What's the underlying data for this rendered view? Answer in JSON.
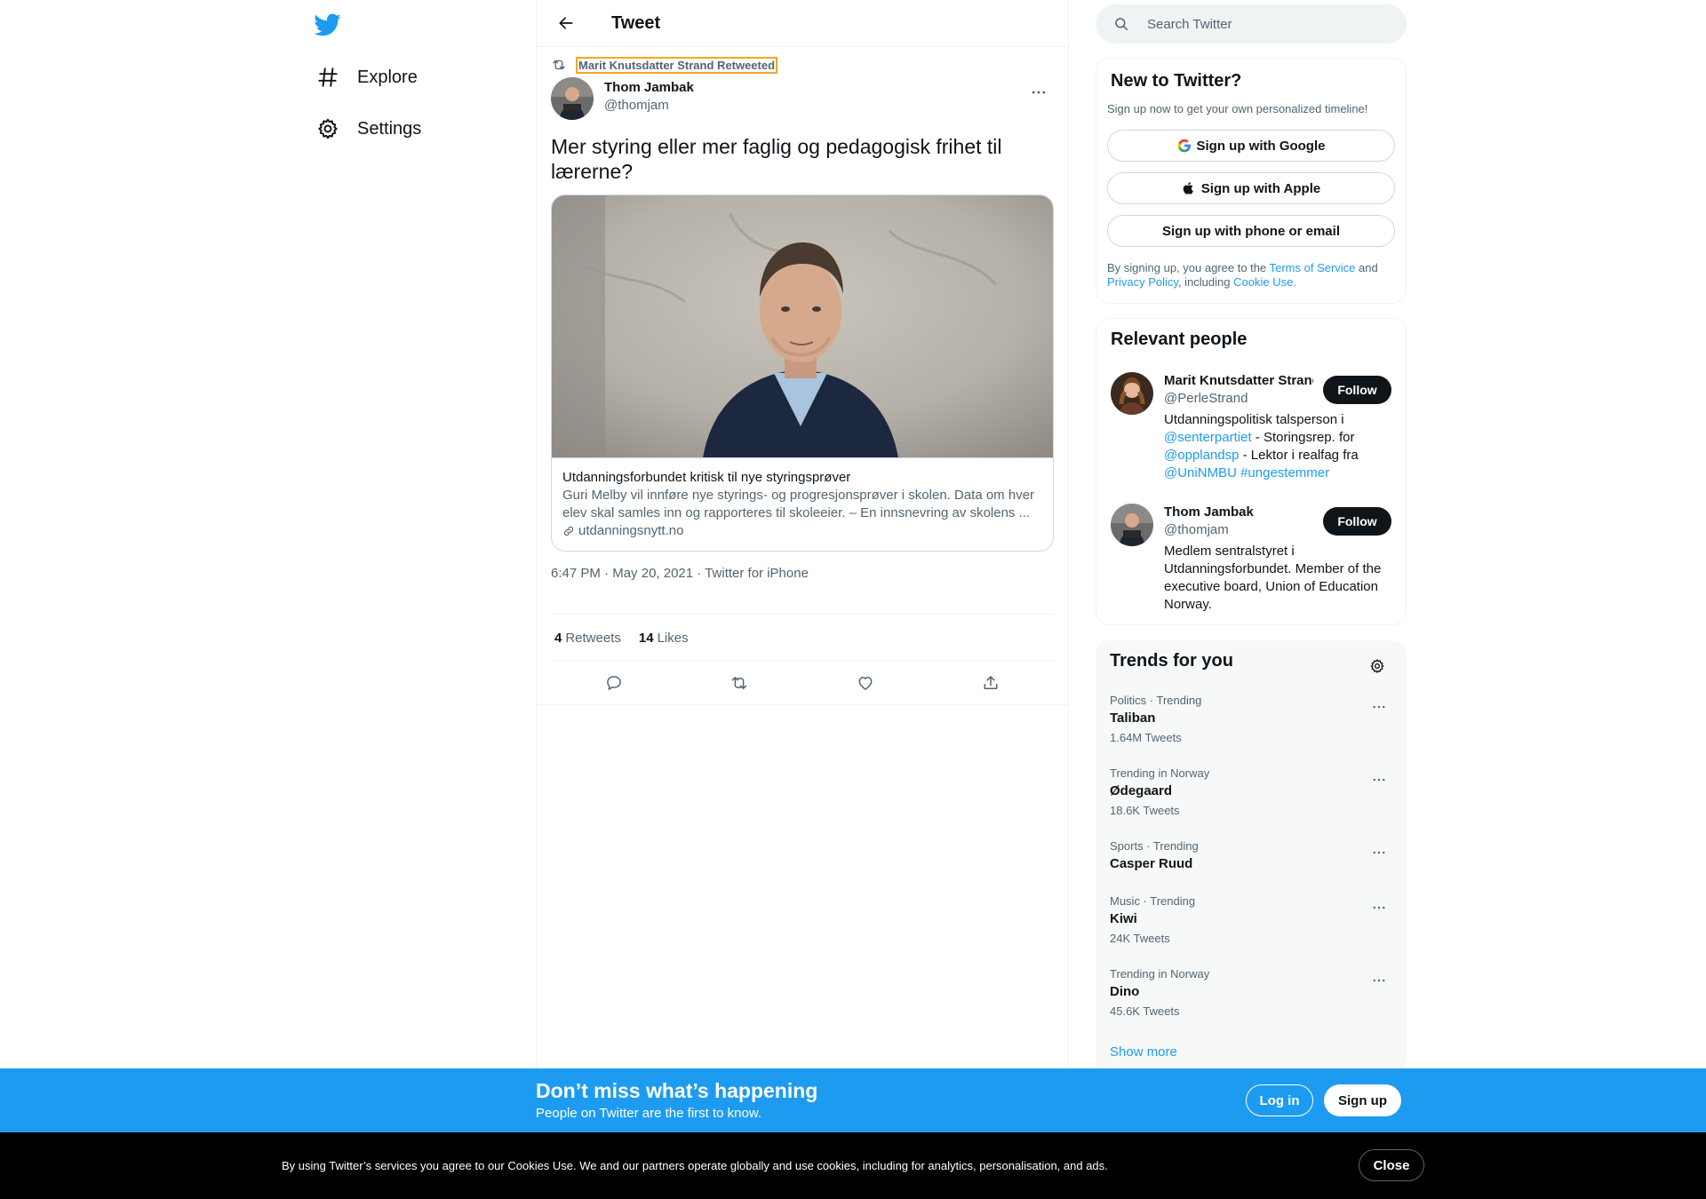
{
  "nav": {
    "items": [
      {
        "label": "Explore",
        "icon": "hash-icon"
      },
      {
        "label": "Settings",
        "icon": "gear-icon"
      }
    ]
  },
  "header": {
    "title": "Tweet"
  },
  "tweet": {
    "retweeted_by": "Marit Knutsdatter Strand Retweeted",
    "author_name": "Thom Jambak",
    "author_handle": "@thomjam",
    "text": "Mer styring eller mer faglig og pedagogisk frihet til lærerne?",
    "card": {
      "title": "Utdanningsforbundet kritisk til nye styringsprøver",
      "description_line1": "Guri Melby vil innføre nye styrings- og progresjonsprøver i skolen. Data om hver",
      "description_line2": "elev skal samles inn og rapporteres til skoleeier. – En innsnevring av skolens ...",
      "domain": "utdanningsnytt.no"
    },
    "time": "6:47 PM",
    "date": "May 20, 2021",
    "source": "Twitter for iPhone",
    "separator": " · ",
    "retweets_count": "4",
    "retweets_label": "Retweets",
    "likes_count": "14",
    "likes_label": "Likes"
  },
  "search": {
    "placeholder": "Search Twitter"
  },
  "new_to_twitter": {
    "title": "New to Twitter?",
    "subtitle": "Sign up now to get your own personalized timeline!",
    "google": "Sign up with Google",
    "apple": "Sign up with Apple",
    "phone": "Sign up with phone or email",
    "terms_prefix": "By signing up, you agree to the ",
    "terms_link": "Terms of Service",
    "terms_and": " and",
    "privacy_link": "Privacy Policy",
    "including": ", including ",
    "cookie_link": "Cookie Use."
  },
  "relevant": {
    "title": "Relevant people",
    "follow_label": "Follow",
    "people": [
      {
        "name": "Marit Knutsdatter Strand",
        "handle": "@PerleStrand",
        "bio_1": "Utdanningspolitisk talsperson i",
        "bio_link1": "@senterpartiet",
        "bio_2": " - Storingsrep. for",
        "bio_link2": "@opplandsp",
        "bio_3": " - Lektor i realfag fra",
        "bio_link3": "@UniNMBU",
        "bio_link4": "#ungestemmer"
      },
      {
        "name": "Thom Jambak",
        "handle": "@thomjam",
        "bio": "Medlem sentralstyret i Utdanningsforbundet. Member of the executive board, Union of Education Norway."
      }
    ]
  },
  "trends": {
    "title": "Trends for you",
    "items": [
      {
        "context": "Politics · Trending",
        "name": "Taliban",
        "count": "1.64M Tweets"
      },
      {
        "context": "Trending in Norway",
        "name": "Ødegaard",
        "count": "18.6K Tweets"
      },
      {
        "context": "Sports · Trending",
        "name": "Casper Ruud",
        "count": ""
      },
      {
        "context": "Music · Trending",
        "name": "Kiwi",
        "count": "24K Tweets"
      },
      {
        "context": "Trending in Norway",
        "name": "Dino",
        "count": "45.6K Tweets"
      }
    ],
    "show_more": "Show more"
  },
  "signup_bar": {
    "title": "Don’t miss what’s happening",
    "subtitle": "People on Twitter are the first to know.",
    "login": "Log in",
    "signup": "Sign up"
  },
  "cookie_bar": {
    "text": "By using Twitter’s services you agree to our Cookies Use. We and our partners operate globally and use cookies, including for analytics, personalisation, and ads.",
    "close": "Close"
  },
  "colors": {
    "accent": "#1d9bf0",
    "text_primary": "#0f1419",
    "text_secondary": "#536471",
    "cookie_bg": "#000000"
  }
}
